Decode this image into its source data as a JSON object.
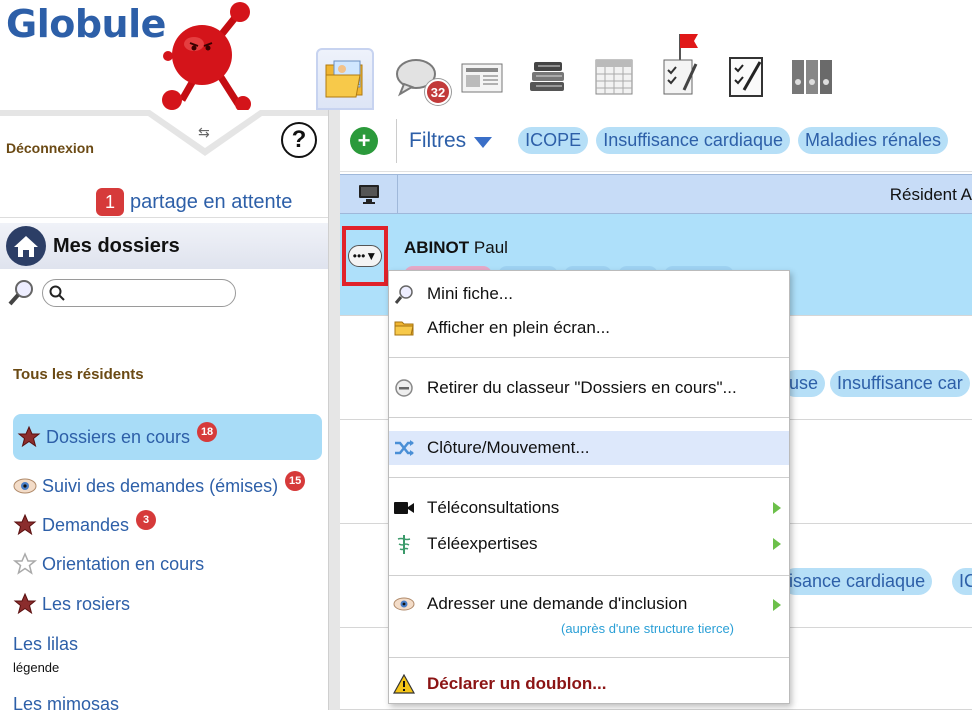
{
  "app": {
    "name": "Globule"
  },
  "toolbar": {
    "tools": [
      {
        "name": "dossiers",
        "icon": "folder-photo-icon",
        "active": true
      },
      {
        "name": "messages",
        "icon": "speech-bubble-icon",
        "badge": "32"
      },
      {
        "name": "journal",
        "icon": "newspaper-icon"
      },
      {
        "name": "library",
        "icon": "books-icon"
      },
      {
        "name": "calendar",
        "icon": "calendar-icon"
      },
      {
        "name": "tasks",
        "icon": "clipboard-flag-icon"
      },
      {
        "name": "checklist",
        "icon": "checklist-icon"
      },
      {
        "name": "archives",
        "icon": "binders-icon"
      }
    ]
  },
  "left": {
    "logout": "Déconnexion",
    "help": "?",
    "pending": {
      "count": "1",
      "label": "partage en attente"
    },
    "section_title": "Mes dossiers",
    "search": {
      "value": "",
      "placeholder": ""
    },
    "all_residents": "Tous les résidents",
    "items": [
      {
        "label": "Dossiers en cours",
        "badge": "18",
        "icon": "star-icon",
        "selected": true
      },
      {
        "label": "Suivi des demandes (émises)",
        "badge": "15",
        "icon": "eye-icon"
      },
      {
        "label": "Demandes",
        "badge": "3",
        "icon": "star-icon"
      },
      {
        "label": "Orientation en cours",
        "icon": "star-outline-icon"
      },
      {
        "label": "Les rosiers",
        "icon": "star-icon"
      },
      {
        "label": "Les lilas",
        "icon": ""
      },
      {
        "label": "Les mimosas",
        "icon": ""
      }
    ],
    "legend": "légende"
  },
  "right": {
    "filters_label": "Filtres",
    "filter_chips": [
      "ICOPE",
      "Insuffisance cardiaque",
      "Maladies rénales"
    ],
    "column_title": "Résident A",
    "selected_patient": {
      "last": "ABINOT",
      "first": "Paul"
    },
    "row_chips": {
      "row2": [
        "use",
        "Insuffisance car"
      ],
      "row3": [
        "isance cardiaque",
        "IC"
      ]
    }
  },
  "context_menu": {
    "items": [
      {
        "label": "Mini fiche...",
        "icon": "magnifier-icon"
      },
      {
        "label": "Afficher en plein écran...",
        "icon": "folder-icon"
      },
      {
        "label": "Retirer du classeur \"Dossiers en cours\"...",
        "icon": "minus-circle-icon"
      },
      {
        "label": "Clôture/Mouvement...",
        "icon": "shuffle-icon",
        "highlighted": true
      },
      {
        "label": "Téléconsultations",
        "icon": "video-camera-icon",
        "submenu": true
      },
      {
        "label": "Téléexpertises",
        "icon": "caduceus-icon",
        "submenu": true
      },
      {
        "label": "Adresser une demande d'inclusion",
        "icon": "eye-icon",
        "submenu": true
      },
      {
        "label": "Déclarer un doublon...",
        "icon": "warning-icon",
        "danger": true
      }
    ],
    "inclusion_sub": "(auprès d'une structure tierce)"
  },
  "colors": {
    "brand_blue": "#2d5fa8",
    "selected_row": "#aee0fa",
    "chip": "#b6dff7",
    "badge_red": "#d63a3a",
    "highlight_box": "#e0222a"
  }
}
